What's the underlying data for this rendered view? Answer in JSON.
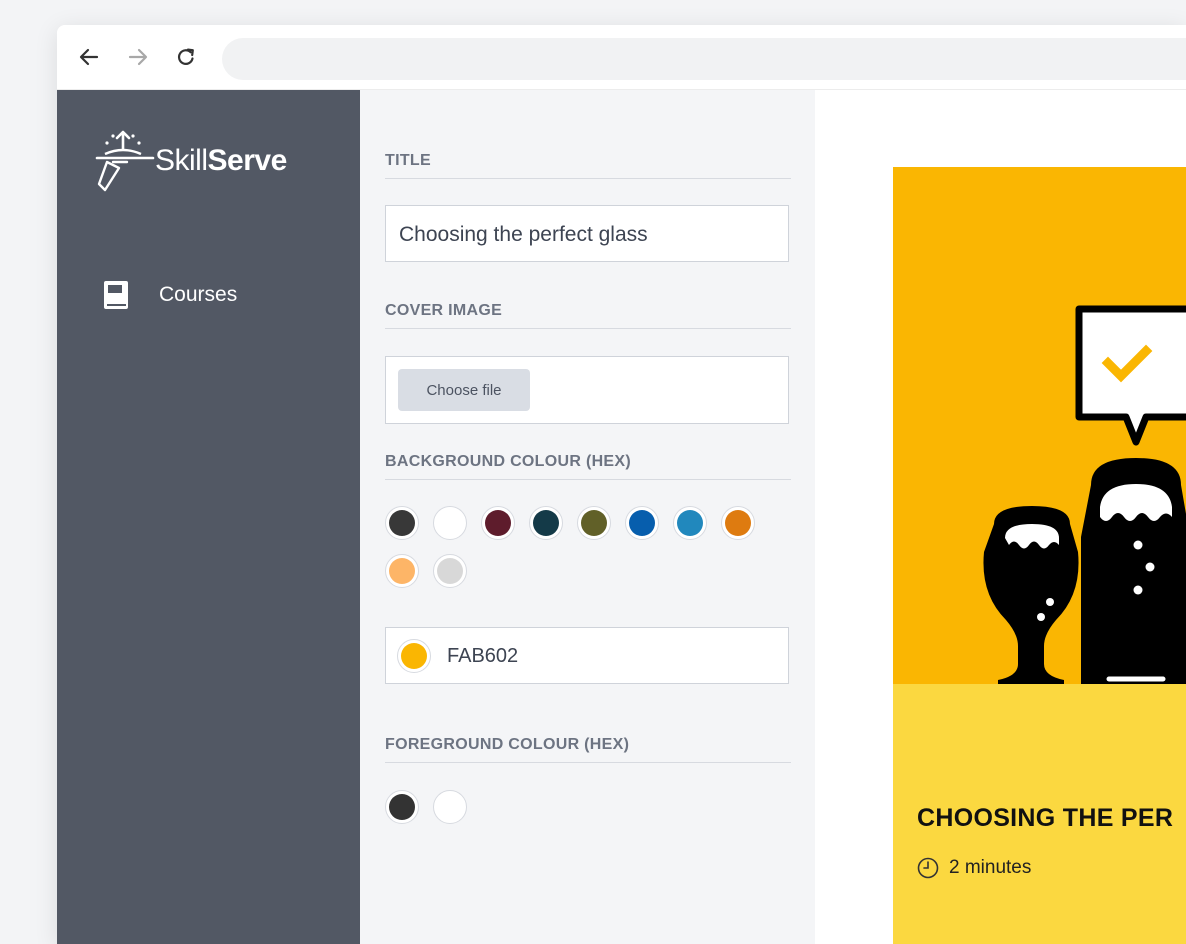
{
  "app": {
    "logo": {
      "text_light": "Skill",
      "text_bold": "Serve"
    },
    "sidebar": {
      "items": [
        {
          "label": "Courses",
          "icon": "book-icon"
        }
      ]
    }
  },
  "form": {
    "title_label": "TITLE",
    "title_value": "Choosing the perfect glass",
    "cover_label": "COVER IMAGE",
    "choose_file_label": "Choose file",
    "bg_label": "BACKGROUND COLOUR (HEX)",
    "bg_swatches": [
      "#383838",
      "#ffffff",
      "#5e1c2c",
      "#143a48",
      "#616028",
      "#075ead",
      "#2188bd",
      "#de7b10",
      "#fdb567",
      "#d8d8d8"
    ],
    "bg_hex": "FAB602",
    "fg_label": "FOREGROUND COLOUR (HEX)",
    "fg_swatches": [
      "#333333",
      "#ffffff"
    ]
  },
  "preview": {
    "title": "CHOOSING THE PER",
    "duration": "2 minutes",
    "top_color": "#fab602",
    "bottom_color": "#fbd840"
  },
  "colors": {
    "sidebar": "#525864",
    "form_bg": "#f4f5f7"
  }
}
